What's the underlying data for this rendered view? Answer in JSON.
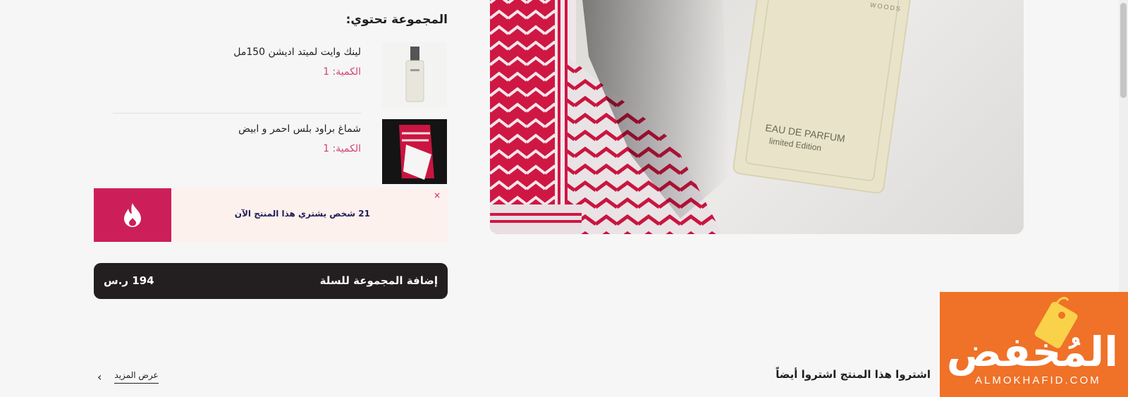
{
  "bundle": {
    "title": "المجموعة تحتوي:",
    "items": [
      {
        "name": "لينك وايت لميتد اديشن 150مل",
        "quantity": "الكمية: 1",
        "thumb_icon": "perfume-bottle-icon"
      },
      {
        "name": "شماغ براود بلس احمر و ابيض",
        "quantity": "الكمية: 1",
        "thumb_icon": "shemagh-icon"
      }
    ]
  },
  "social_proof": {
    "text": "21 شخص يشتري هذا المنتج الآن",
    "icon": "flame-icon",
    "close_label": "×"
  },
  "add_to_cart": {
    "label": "إضافة المجموعة للسلة",
    "price": "194 ر.س"
  },
  "hero": {
    "bottle_brand": "WOODS",
    "bottle_line1": "EAU DE PARFUM",
    "bottle_line2": "limited Edition"
  },
  "related": {
    "title": "اشتروا هذا المنتج اشتروا أيضاً",
    "view_more": "عرض المزيد"
  },
  "watermark": {
    "word": "المُخفض",
    "domain": "ALMOKHAFID.COM"
  },
  "colors": {
    "accent_pink": "#cc1f5a",
    "qty_pink": "#d4436e",
    "cart_dark": "#231f20",
    "proof_bg": "#fdf1ee",
    "watermark_orange": "#f07128"
  }
}
